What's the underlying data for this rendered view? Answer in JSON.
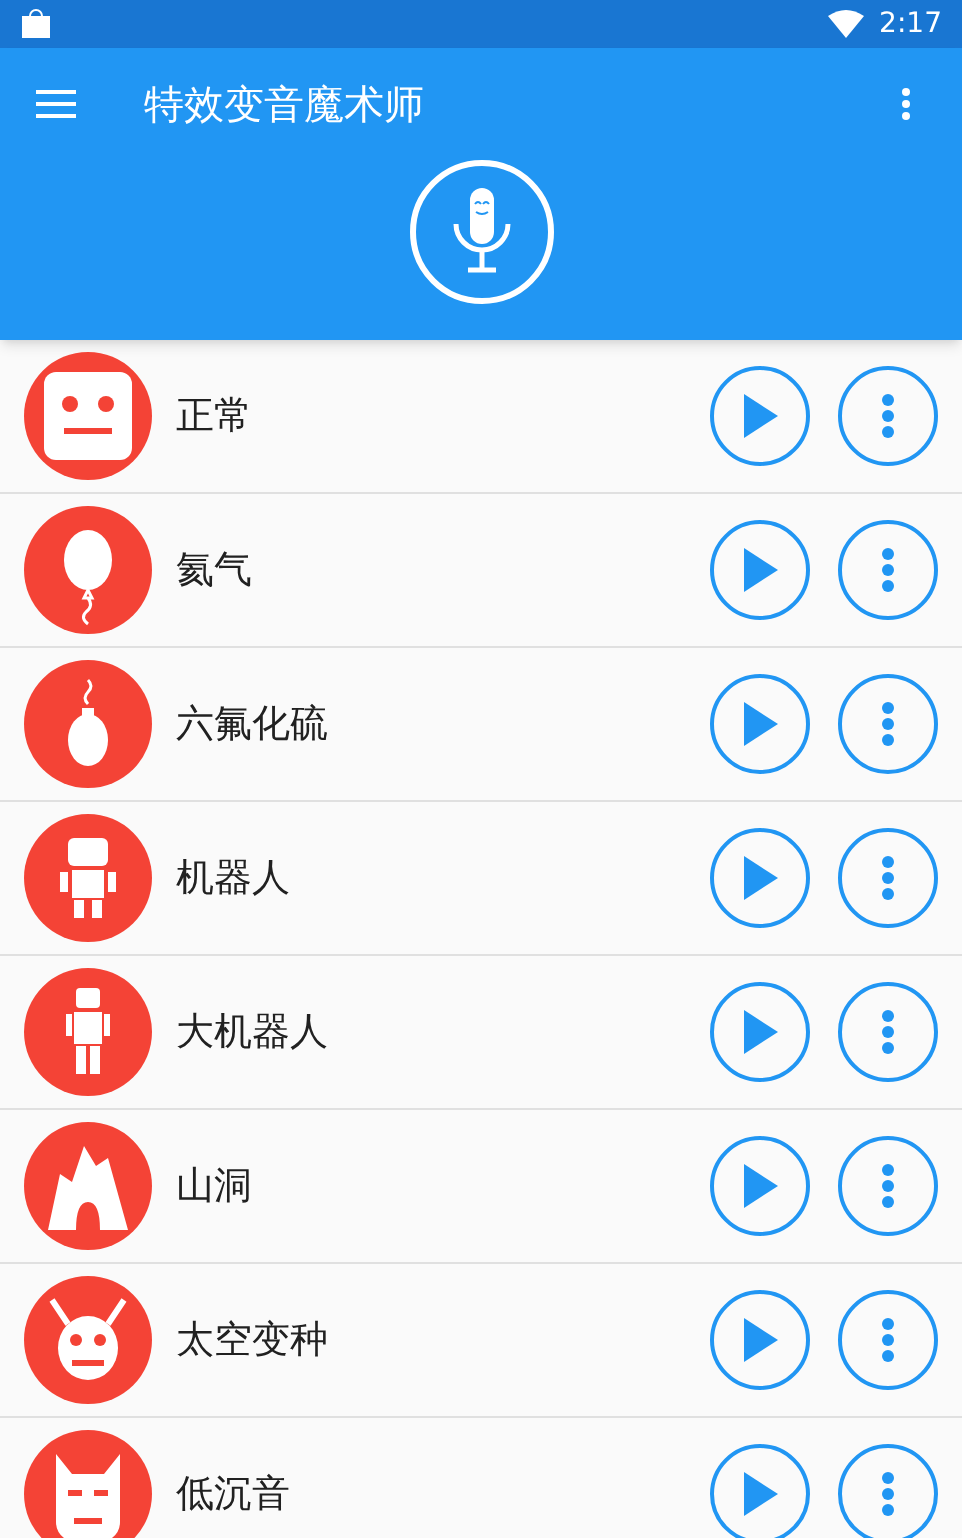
{
  "status_bar": {
    "time": "2:17"
  },
  "app_bar": {
    "title": "特效变音魔术师"
  },
  "effects": [
    {
      "name": "正常",
      "kind": "face"
    },
    {
      "name": "氦气",
      "kind": "balloon"
    },
    {
      "name": "六氟化硫",
      "kind": "bulb"
    },
    {
      "name": "机器人",
      "kind": "robot"
    },
    {
      "name": "大机器人",
      "kind": "bigrobot"
    },
    {
      "name": "山洞",
      "kind": "cave"
    },
    {
      "name": "太空变种",
      "kind": "alien"
    },
    {
      "name": "低沉音",
      "kind": "mask"
    }
  ]
}
